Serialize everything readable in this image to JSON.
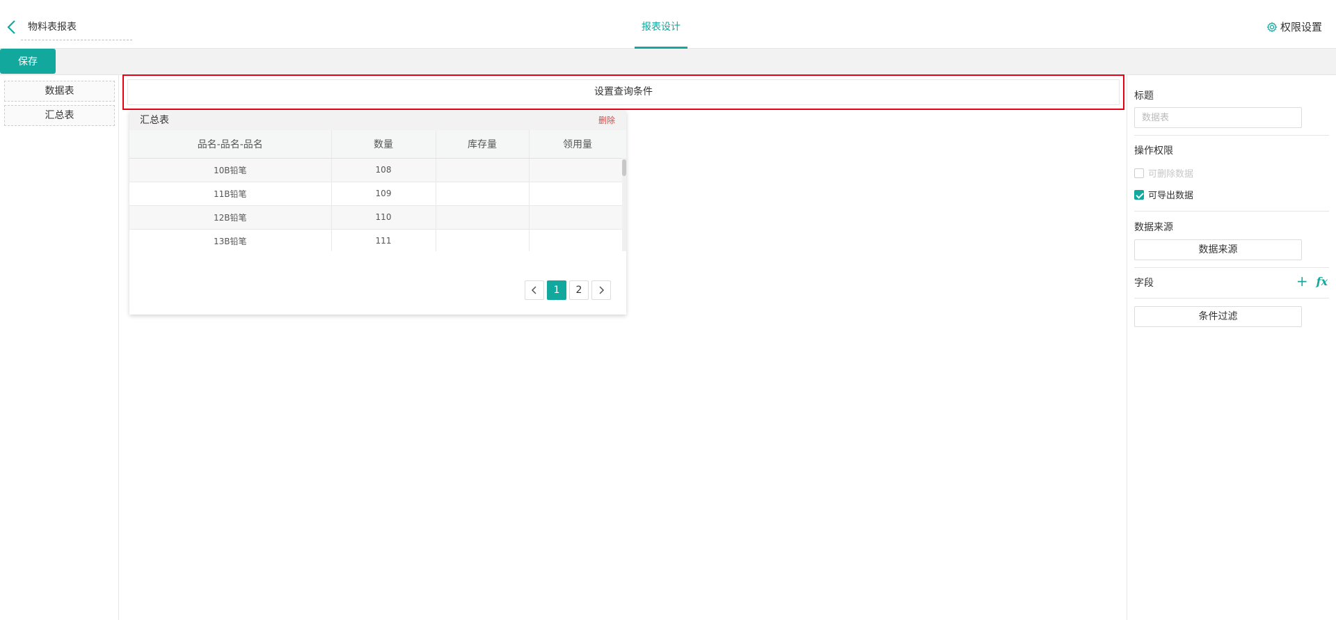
{
  "header": {
    "doc_title": "物料表报表",
    "tab_design": "报表设计",
    "permission_setting": "权限设置"
  },
  "toolbar": {
    "save_label": "保存"
  },
  "left_sidebar": {
    "items": [
      {
        "label": "数据表"
      },
      {
        "label": "汇总表"
      }
    ]
  },
  "main": {
    "query_button": "设置查询条件",
    "card": {
      "title": "汇总表",
      "delete_label": "删除",
      "columns": [
        "品名-品名-品名",
        "数量",
        "库存量",
        "领用量"
      ],
      "rows": [
        [
          "10B铅笔",
          "108",
          "",
          ""
        ],
        [
          "11B铅笔",
          "109",
          "",
          ""
        ],
        [
          "12B铅笔",
          "110",
          "",
          ""
        ],
        [
          "13B铅笔",
          "111",
          "",
          ""
        ]
      ],
      "pagination": {
        "pages": [
          "1",
          "2"
        ],
        "current": "1"
      }
    }
  },
  "right_sidebar": {
    "title_label": "标题",
    "title_placeholder": "数据表",
    "operation_label": "操作权限",
    "can_delete_label": "可删除数据",
    "can_delete_checked": false,
    "can_export_label": "可导出数据",
    "can_export_checked": true,
    "data_source_label": "数据来源",
    "data_source_button": "数据来源",
    "fields_label": "字段",
    "fx_label": "fx",
    "filter_button": "条件过滤"
  },
  "colors": {
    "accent": "#13a89e",
    "highlight_border": "#e60012",
    "delete_text": "#e04444"
  }
}
